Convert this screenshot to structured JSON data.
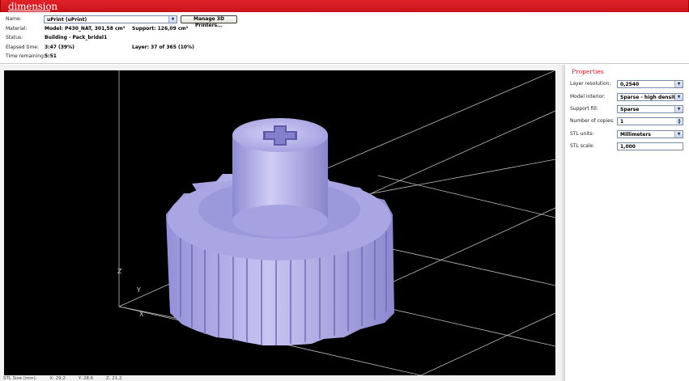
{
  "header": {
    "logo": "dimension"
  },
  "info": {
    "name_label": "Name:",
    "name_value": "uPrint  (uPrint)",
    "manage_button": "Manage 3D Printers...",
    "material_label": "Material:",
    "model_value": "Model: P430_NAT, 301,58 cm³",
    "support_value": "Support: 126,09 cm³",
    "status_label": "Status:",
    "status_value": "Building - Pack_bridel1",
    "elapsed_label": "Elapsed time:",
    "elapsed_value": "3:47  (39%)",
    "layer_value": "Layer: 37 of 365  (10%)",
    "remaining_label": "Time remaining:",
    "remaining_value": "5:51"
  },
  "viewport": {
    "axis_z": "Z",
    "axis_y": "Y",
    "axis_x": "X",
    "model_color": "#b7b3e8",
    "background": "#000000",
    "grid_color": "#bdbdbd"
  },
  "properties": {
    "title": "Properties",
    "layer_resolution_label": "Layer resolution:",
    "layer_resolution_value": "0,2540",
    "model_interior_label": "Model interior:",
    "model_interior_value": "Sparse - high density",
    "support_fill_label": "Support fill:",
    "support_fill_value": "Sparse",
    "copies_label": "Number of copies:",
    "copies_value": "1",
    "stl_units_label": "STL units:",
    "stl_units_value": "Millimeters",
    "stl_scale_label": "STL scale:",
    "stl_scale_value": "1,000"
  },
  "statusbar": {
    "stl_size_label": "STL Size (mm):",
    "x_value": "X: 29,2",
    "y_value": "Y: 28,6",
    "z_value": "Z: 21,2"
  },
  "colors": {
    "brand_red": "#d8171e"
  }
}
